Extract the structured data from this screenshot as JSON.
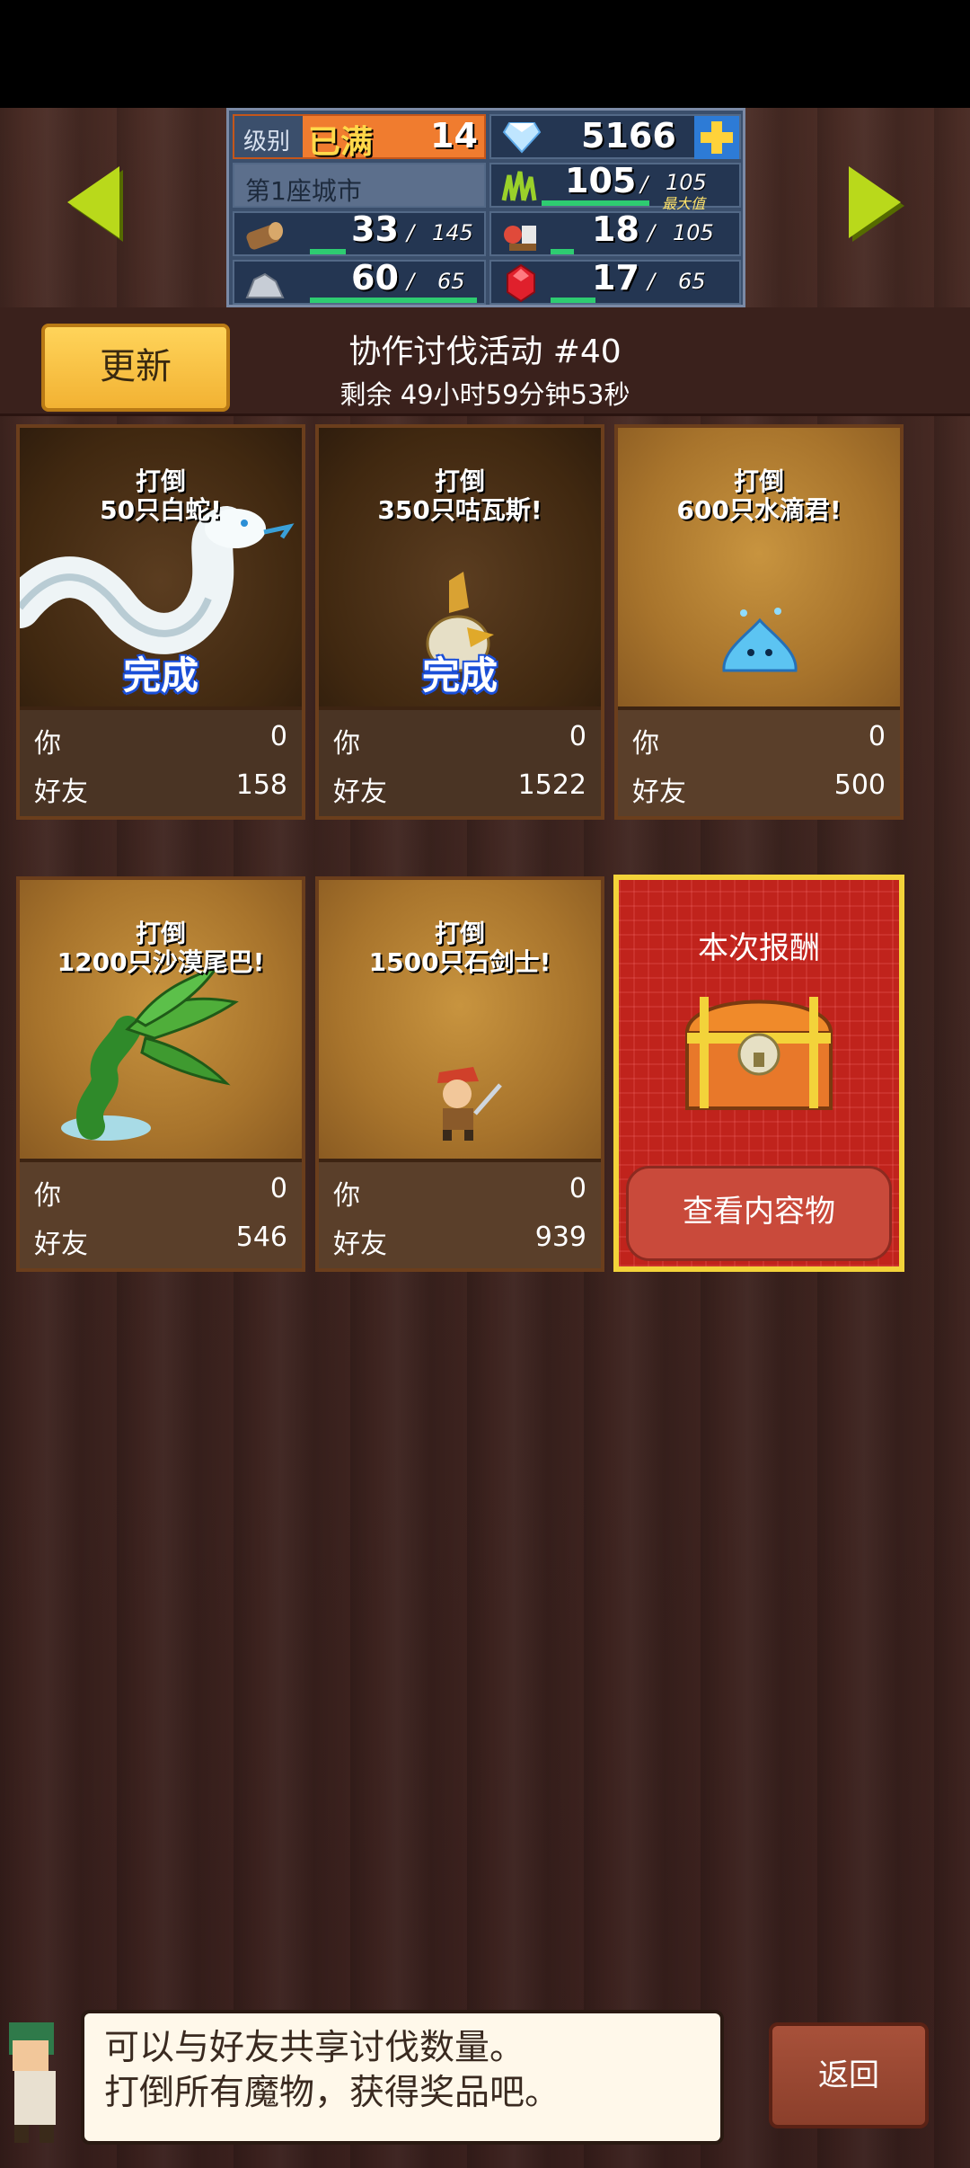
{
  "resources": {
    "level_label": "级别",
    "level_status": "已满",
    "level_value": "14",
    "gems": "5166",
    "city_name": "第1座城市",
    "grass_value": "105",
    "grass_max": "105",
    "grass_max_tag": "最大值",
    "wood_value": "33",
    "wood_max": "145",
    "food_value": "18",
    "food_max": "105",
    "ore_value": "60",
    "ore_max": "65",
    "ruby_value": "17",
    "ruby_max": "65",
    "slash": "/"
  },
  "header": {
    "refresh_label": "更新",
    "event_title": "协作讨伐活动 #40",
    "event_time": "剩余 49小时59分钟53秒"
  },
  "cards": [
    {
      "goal_line1": "打倒",
      "goal_line2": "50只白蛇!",
      "status": "完成",
      "you_label": "你",
      "you": "0",
      "friends_label": "好友",
      "friends": "158"
    },
    {
      "goal_line1": "打倒",
      "goal_line2": "350只咕瓦斯!",
      "status": "完成",
      "you_label": "你",
      "you": "0",
      "friends_label": "好友",
      "friends": "1522"
    },
    {
      "goal_line1": "打倒",
      "goal_line2": "600只水滴君!",
      "status": "",
      "you_label": "你",
      "you": "0",
      "friends_label": "好友",
      "friends": "500"
    },
    {
      "goal_line1": "打倒",
      "goal_line2": "1200只沙漠尾巴!",
      "status": "",
      "you_label": "你",
      "you": "0",
      "friends_label": "好友",
      "friends": "546"
    },
    {
      "goal_line1": "打倒",
      "goal_line2": "1500只石剑士!",
      "status": "",
      "you_label": "你",
      "you": "0",
      "friends_label": "好友",
      "friends": "939"
    }
  ],
  "reward": {
    "title": "本次报酬",
    "view_label": "查看内容物"
  },
  "tip": {
    "line1": "可以与好友共享讨伐数量。",
    "line2": "打倒所有魔物，获得奖品吧。"
  },
  "back_label": "返回",
  "colors": {
    "accent_green": "#b9d91b",
    "complete_blue": "#1a4fd8",
    "reward_red": "#c0231c",
    "gold": "#f3d33a"
  },
  "icons": [
    "diamond-icon",
    "plus-icon",
    "grass-icon",
    "wood-icon",
    "food-icon",
    "ore-icon",
    "ruby-icon",
    "arrow-left-icon",
    "arrow-right-icon",
    "treasure-chest-icon"
  ]
}
